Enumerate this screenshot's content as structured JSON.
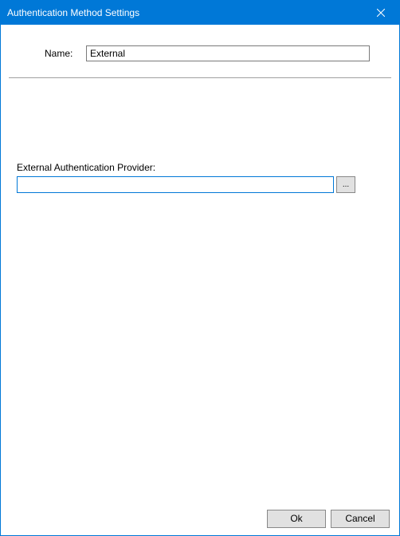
{
  "window": {
    "title": "Authentication Method Settings"
  },
  "form": {
    "nameLabel": "Name:",
    "nameValue": "External",
    "externalLabel": "External Authentication Provider:",
    "externalValue": "",
    "browseLabel": "..."
  },
  "buttons": {
    "ok": "Ok",
    "cancel": "Cancel"
  }
}
